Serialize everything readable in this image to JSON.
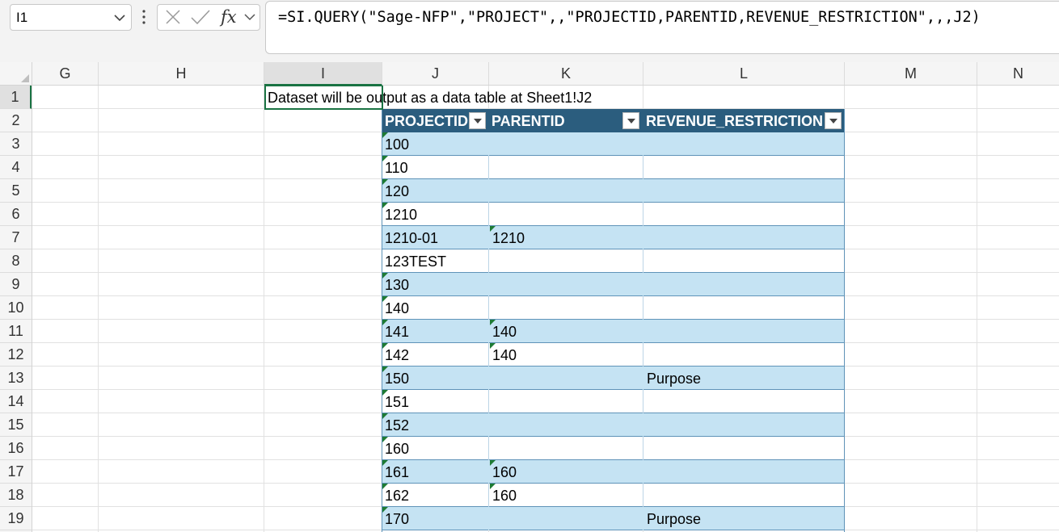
{
  "name_box": {
    "value": "I1"
  },
  "formula": {
    "text": "=SI.QUERY(\"Sage-NFP\",\"PROJECT\",,\"PROJECTID,PARENTID,REVENUE_RESTRICTION\",,,J2)"
  },
  "formula_tools": {
    "icons": [
      "cancel-icon",
      "enter-icon",
      "fx-icon",
      "chevron-down-icon"
    ],
    "fx_label": "fx"
  },
  "columns": [
    "G",
    "H",
    "I",
    "J",
    "K",
    "L",
    "M",
    "N"
  ],
  "selected_column": "I",
  "rows": [
    "1",
    "2",
    "3",
    "4",
    "5",
    "6",
    "7",
    "8",
    "9",
    "10",
    "11",
    "12",
    "13",
    "14",
    "15",
    "16",
    "17",
    "18",
    "19"
  ],
  "selected_row": "1",
  "cell_i1": {
    "text": "Dataset will be output as a data table at Sheet1!J2"
  },
  "table": {
    "headers": [
      "PROJECTID",
      "PARENTID",
      "REVENUE_RESTRICTION"
    ],
    "rows": [
      {
        "projectid": "100",
        "parentid": "",
        "restriction": ""
      },
      {
        "projectid": "110",
        "parentid": "",
        "restriction": ""
      },
      {
        "projectid": "120",
        "parentid": "",
        "restriction": ""
      },
      {
        "projectid": "1210",
        "parentid": "",
        "restriction": ""
      },
      {
        "projectid": "1210-01",
        "parentid": "1210",
        "restriction": ""
      },
      {
        "projectid": "123TEST",
        "parentid": "",
        "restriction": ""
      },
      {
        "projectid": "130",
        "parentid": "",
        "restriction": ""
      },
      {
        "projectid": "140",
        "parentid": "",
        "restriction": ""
      },
      {
        "projectid": "141",
        "parentid": "140",
        "restriction": ""
      },
      {
        "projectid": "142",
        "parentid": "140",
        "restriction": ""
      },
      {
        "projectid": "150",
        "parentid": "",
        "restriction": "Purpose"
      },
      {
        "projectid": "151",
        "parentid": "",
        "restriction": ""
      },
      {
        "projectid": "152",
        "parentid": "",
        "restriction": ""
      },
      {
        "projectid": "160",
        "parentid": "",
        "restriction": ""
      },
      {
        "projectid": "161",
        "parentid": "160",
        "restriction": ""
      },
      {
        "projectid": "162",
        "parentid": "160",
        "restriction": ""
      },
      {
        "projectid": "170",
        "parentid": "",
        "restriction": "Purpose"
      }
    ]
  },
  "colors": {
    "accent": "#1a7343",
    "table_header": "#2b5d7e",
    "band": "#c5e3f3",
    "flag": "#1e7b34"
  }
}
